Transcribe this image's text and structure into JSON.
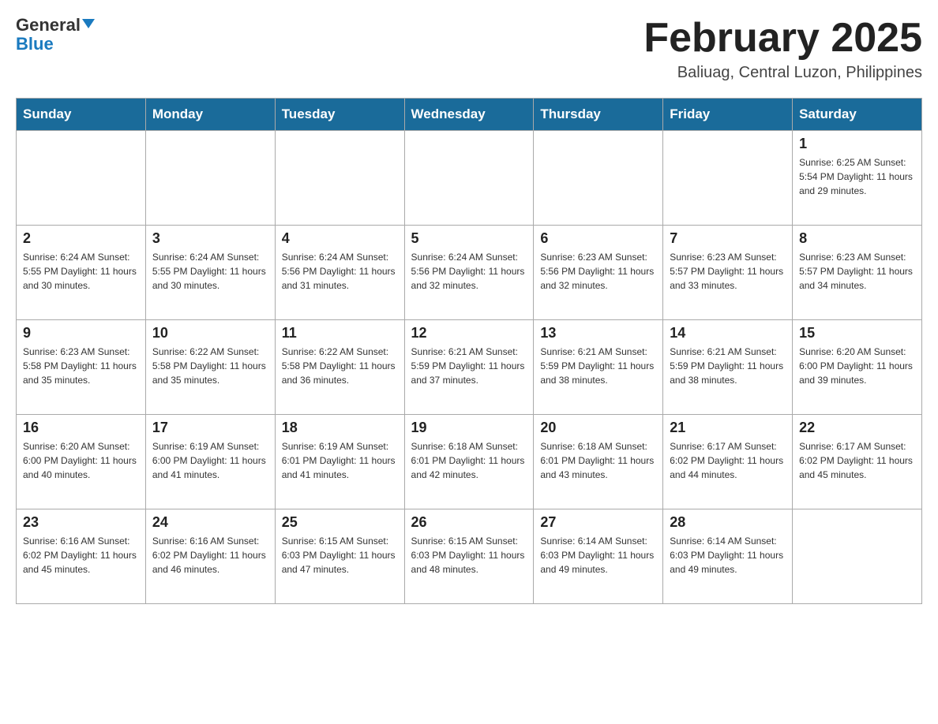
{
  "header": {
    "logo_general": "General",
    "logo_blue": "Blue",
    "month_title": "February 2025",
    "location": "Baliuag, Central Luzon, Philippines"
  },
  "days_of_week": [
    "Sunday",
    "Monday",
    "Tuesday",
    "Wednesday",
    "Thursday",
    "Friday",
    "Saturday"
  ],
  "weeks": [
    [
      {
        "day": "",
        "info": ""
      },
      {
        "day": "",
        "info": ""
      },
      {
        "day": "",
        "info": ""
      },
      {
        "day": "",
        "info": ""
      },
      {
        "day": "",
        "info": ""
      },
      {
        "day": "",
        "info": ""
      },
      {
        "day": "1",
        "info": "Sunrise: 6:25 AM\nSunset: 5:54 PM\nDaylight: 11 hours and 29 minutes."
      }
    ],
    [
      {
        "day": "2",
        "info": "Sunrise: 6:24 AM\nSunset: 5:55 PM\nDaylight: 11 hours and 30 minutes."
      },
      {
        "day": "3",
        "info": "Sunrise: 6:24 AM\nSunset: 5:55 PM\nDaylight: 11 hours and 30 minutes."
      },
      {
        "day": "4",
        "info": "Sunrise: 6:24 AM\nSunset: 5:56 PM\nDaylight: 11 hours and 31 minutes."
      },
      {
        "day": "5",
        "info": "Sunrise: 6:24 AM\nSunset: 5:56 PM\nDaylight: 11 hours and 32 minutes."
      },
      {
        "day": "6",
        "info": "Sunrise: 6:23 AM\nSunset: 5:56 PM\nDaylight: 11 hours and 32 minutes."
      },
      {
        "day": "7",
        "info": "Sunrise: 6:23 AM\nSunset: 5:57 PM\nDaylight: 11 hours and 33 minutes."
      },
      {
        "day": "8",
        "info": "Sunrise: 6:23 AM\nSunset: 5:57 PM\nDaylight: 11 hours and 34 minutes."
      }
    ],
    [
      {
        "day": "9",
        "info": "Sunrise: 6:23 AM\nSunset: 5:58 PM\nDaylight: 11 hours and 35 minutes."
      },
      {
        "day": "10",
        "info": "Sunrise: 6:22 AM\nSunset: 5:58 PM\nDaylight: 11 hours and 35 minutes."
      },
      {
        "day": "11",
        "info": "Sunrise: 6:22 AM\nSunset: 5:58 PM\nDaylight: 11 hours and 36 minutes."
      },
      {
        "day": "12",
        "info": "Sunrise: 6:21 AM\nSunset: 5:59 PM\nDaylight: 11 hours and 37 minutes."
      },
      {
        "day": "13",
        "info": "Sunrise: 6:21 AM\nSunset: 5:59 PM\nDaylight: 11 hours and 38 minutes."
      },
      {
        "day": "14",
        "info": "Sunrise: 6:21 AM\nSunset: 5:59 PM\nDaylight: 11 hours and 38 minutes."
      },
      {
        "day": "15",
        "info": "Sunrise: 6:20 AM\nSunset: 6:00 PM\nDaylight: 11 hours and 39 minutes."
      }
    ],
    [
      {
        "day": "16",
        "info": "Sunrise: 6:20 AM\nSunset: 6:00 PM\nDaylight: 11 hours and 40 minutes."
      },
      {
        "day": "17",
        "info": "Sunrise: 6:19 AM\nSunset: 6:00 PM\nDaylight: 11 hours and 41 minutes."
      },
      {
        "day": "18",
        "info": "Sunrise: 6:19 AM\nSunset: 6:01 PM\nDaylight: 11 hours and 41 minutes."
      },
      {
        "day": "19",
        "info": "Sunrise: 6:18 AM\nSunset: 6:01 PM\nDaylight: 11 hours and 42 minutes."
      },
      {
        "day": "20",
        "info": "Sunrise: 6:18 AM\nSunset: 6:01 PM\nDaylight: 11 hours and 43 minutes."
      },
      {
        "day": "21",
        "info": "Sunrise: 6:17 AM\nSunset: 6:02 PM\nDaylight: 11 hours and 44 minutes."
      },
      {
        "day": "22",
        "info": "Sunrise: 6:17 AM\nSunset: 6:02 PM\nDaylight: 11 hours and 45 minutes."
      }
    ],
    [
      {
        "day": "23",
        "info": "Sunrise: 6:16 AM\nSunset: 6:02 PM\nDaylight: 11 hours and 45 minutes."
      },
      {
        "day": "24",
        "info": "Sunrise: 6:16 AM\nSunset: 6:02 PM\nDaylight: 11 hours and 46 minutes."
      },
      {
        "day": "25",
        "info": "Sunrise: 6:15 AM\nSunset: 6:03 PM\nDaylight: 11 hours and 47 minutes."
      },
      {
        "day": "26",
        "info": "Sunrise: 6:15 AM\nSunset: 6:03 PM\nDaylight: 11 hours and 48 minutes."
      },
      {
        "day": "27",
        "info": "Sunrise: 6:14 AM\nSunset: 6:03 PM\nDaylight: 11 hours and 49 minutes."
      },
      {
        "day": "28",
        "info": "Sunrise: 6:14 AM\nSunset: 6:03 PM\nDaylight: 11 hours and 49 minutes."
      },
      {
        "day": "",
        "info": ""
      }
    ]
  ]
}
